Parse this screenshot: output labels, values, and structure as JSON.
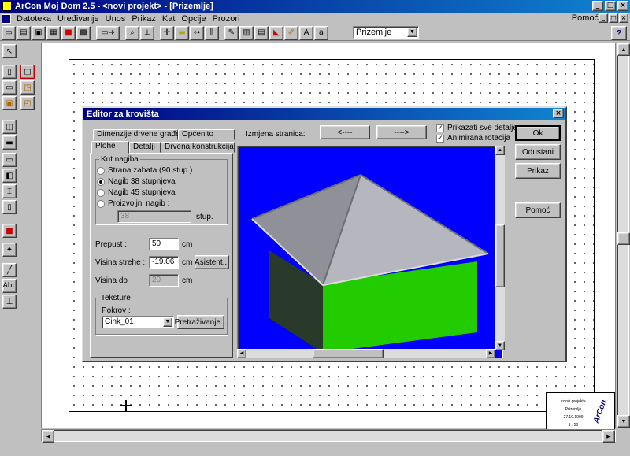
{
  "window": {
    "title": "ArCon Moj Dom  2.5 - <novi projekt> - [Prizemlje]",
    "min_glyph": "_",
    "max_glyph": "□",
    "close_glyph": "×"
  },
  "menu": {
    "items": [
      "Datoteka",
      "Uređivanje",
      "Unos",
      "Prikaz",
      "Kat",
      "Opcije",
      "Prozori"
    ],
    "help": "Pomoć"
  },
  "toolbar": {
    "floor_select": "Prizemlje",
    "help_icon": "?",
    "icons": [
      "new-file-icon",
      "open-folder-icon",
      "save-icon",
      "print-icon",
      "render-icon",
      "tiles-icon",
      "export-icon",
      "zoom-icon",
      "measure-icon",
      "crosshair-icon",
      "ruler-icon",
      "dimension-icon",
      "stairs-icon",
      "brush-icon",
      "grid-icon",
      "fence-icon",
      "color-icon",
      "pencil-icon",
      "text-style-icon",
      "font-size-icon"
    ]
  },
  "left_palette": {
    "icons": [
      "pointer-icon",
      "wall-icon",
      "room-icon",
      "door-icon",
      "window-icon",
      "stairs-icon",
      "roof-icon",
      "column-icon",
      "object-icon",
      "dimension-icon",
      "text-icon",
      "measure-icon",
      "label-icon",
      "grid-icon"
    ],
    "text_labels": {
      "abc": "Abc"
    }
  },
  "titleblock": {
    "line1": "<novi projekt>",
    "line2": "Prizemlje",
    "line3": "27.10.1999",
    "line4": "1 : 50",
    "logo": "ArCon"
  },
  "dialog": {
    "title": "Editor za krovišta",
    "close_glyph": "×",
    "tabs_back": [
      "Dimenzije drvene građe",
      "Općenito"
    ],
    "tabs_front": [
      "Plohe",
      "Detalji",
      "Drvena konstrukcija"
    ],
    "slope_group": {
      "legend": "Kut nagiba",
      "options": [
        {
          "label": "Strana zabata (90 stup.)",
          "checked": false
        },
        {
          "label": "Nagib 38 stupnjeva",
          "checked": true
        },
        {
          "label": "Nagib 45 stupnjeva",
          "checked": false
        },
        {
          "label": "Proizvoljni nagib :",
          "checked": false
        }
      ],
      "custom_value": "38",
      "custom_unit": "stup."
    },
    "overhang": {
      "label": "Prepust :",
      "value": "50",
      "unit": "cm"
    },
    "eave_height": {
      "label": "Visina strehe :",
      "value": "-19.06",
      "unit": "cm",
      "button": "Asistent..."
    },
    "height_to": {
      "label": "Visina do",
      "value": "20",
      "unit": "cm"
    },
    "textures": {
      "legend": "Teksture",
      "cover_label": "Pokrov :",
      "cover_value": "Cink_01",
      "browse_button": "Pretraživanje..."
    },
    "page_change_label": "Izmjena stranica:",
    "prev_button": "<----",
    "next_button": "---->",
    "checkboxes": [
      {
        "label": "Prikazati sve detalje",
        "checked": true
      },
      {
        "label": "Animirana rotacija",
        "checked": true
      }
    ],
    "buttons": {
      "ok": "Ok",
      "cancel": "Odustani",
      "view": "Prikaz",
      "help": "Pomoć"
    },
    "preview_colors": {
      "background": "#0000ff",
      "walls": "#22cc00",
      "dark_wall": "#2a3a2a",
      "roof": "#a9a9b0"
    }
  }
}
